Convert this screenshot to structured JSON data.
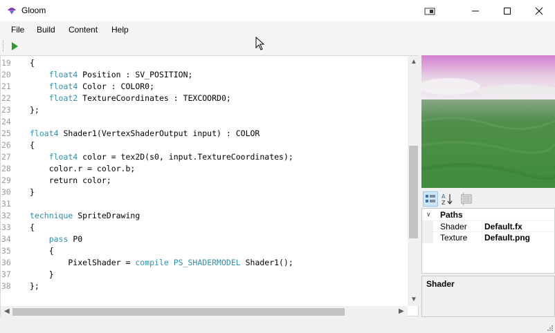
{
  "window": {
    "title": "Gloom",
    "controls": [
      "restore-down-icon",
      "minimize-icon",
      "maximize-icon",
      "close-icon"
    ]
  },
  "menu": {
    "items": [
      "File",
      "Build",
      "Content",
      "Help"
    ]
  },
  "toolbar": {
    "run_icon": "play-icon",
    "run_color": "#2d9b2d"
  },
  "editor": {
    "lines": [
      {
        "n": "19",
        "code": "{"
      },
      {
        "n": "20",
        "code": "    float4 Position : SV_POSITION;"
      },
      {
        "n": "21",
        "code": "    float4 Color : COLOR0;"
      },
      {
        "n": "22",
        "code": "    float2 TextureCoordinates : TEXCOORD0;"
      },
      {
        "n": "23",
        "code": "};"
      },
      {
        "n": "24",
        "code": ""
      },
      {
        "n": "25",
        "code": "float4 Shader1(VertexShaderOutput input) : COLOR"
      },
      {
        "n": "26",
        "code": "{"
      },
      {
        "n": "27",
        "code": "    float4 color = tex2D(s0, input.TextureCoordinates);"
      },
      {
        "n": "28",
        "code": "    color.r = color.b;"
      },
      {
        "n": "29",
        "code": "    return color;"
      },
      {
        "n": "30",
        "code": "}"
      },
      {
        "n": "31",
        "code": ""
      },
      {
        "n": "32",
        "code": "technique SpriteDrawing"
      },
      {
        "n": "33",
        "code": "{"
      },
      {
        "n": "34",
        "code": "    pass P0"
      },
      {
        "n": "35",
        "code": "    {"
      },
      {
        "n": "36",
        "code": "        PixelShader = compile PS_SHADERMODEL Shader1();"
      },
      {
        "n": "37",
        "code": "    }"
      },
      {
        "n": "38",
        "code": "};"
      }
    ],
    "keyword_color": "#2b91af"
  },
  "properties": {
    "toolbar_icons": [
      "categorized-icon",
      "alphabetical-icon",
      "property-pages-icon"
    ],
    "category": "Paths",
    "rows": [
      {
        "name": "Shader",
        "value": "Default.fx"
      },
      {
        "name": "Texture",
        "value": "Default.png"
      }
    ],
    "description_title": "Shader"
  }
}
